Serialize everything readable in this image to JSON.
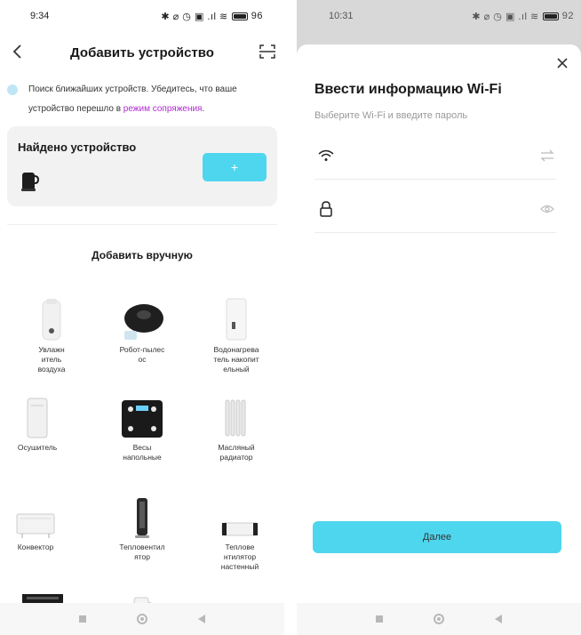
{
  "left": {
    "status": {
      "time": "9:34",
      "icons": "✱ ⌀ ◷ ▣ .ıl ≋",
      "battery": "96"
    },
    "header": {
      "title": "Добавить устройство"
    },
    "search": {
      "text": "Поиск ближайших устройств. Убедитесь, что ваше устройство перешло в ",
      "link": "режим сопряжения",
      "suffix": "."
    },
    "found": {
      "title": "Найдено устройство",
      "add_label": "+"
    },
    "manual": {
      "title": "Добавить вручную",
      "devices": [
        {
          "label": "Увлажн\nитель\nвоздуха",
          "icon": "humidifier-icon"
        },
        {
          "label": "Робот-пылес\nос",
          "icon": "robot-vacuum-icon"
        },
        {
          "label": "Водонагрева\nтель накопит\nельный",
          "icon": "water-heater-icon"
        },
        {
          "label": "Осушитель",
          "icon": "dehumidifier-icon"
        },
        {
          "label": "Весы\nнапольные",
          "icon": "scale-icon"
        },
        {
          "label": "Масляный\nрадиатор",
          "icon": "oil-radiator-icon"
        },
        {
          "label": "Конвектор",
          "icon": "convector-icon"
        },
        {
          "label": "Тепловентил\nятор",
          "icon": "fan-heater-icon"
        },
        {
          "label": "Теплове\nнтилятор\nнастенный",
          "icon": "wall-fan-heater-icon"
        },
        {
          "label": "",
          "icon": "oven-icon"
        },
        {
          "label": "",
          "icon": "kettle-icon"
        }
      ]
    }
  },
  "right": {
    "status": {
      "time": "10:31",
      "icons": "✱ ⌀ ◷ ▣ .ıl ≋",
      "battery": "92"
    },
    "sheet": {
      "title": "Ввести информацию Wi-Fi",
      "subtitle": "Выберите Wi-Fi и введите пароль",
      "ssid_value": "",
      "password_value": "",
      "next_label": "Далее"
    }
  },
  "colors": {
    "accent": "#4fd6ef",
    "link": "#b02bd1",
    "card": "#f2f2f2"
  }
}
